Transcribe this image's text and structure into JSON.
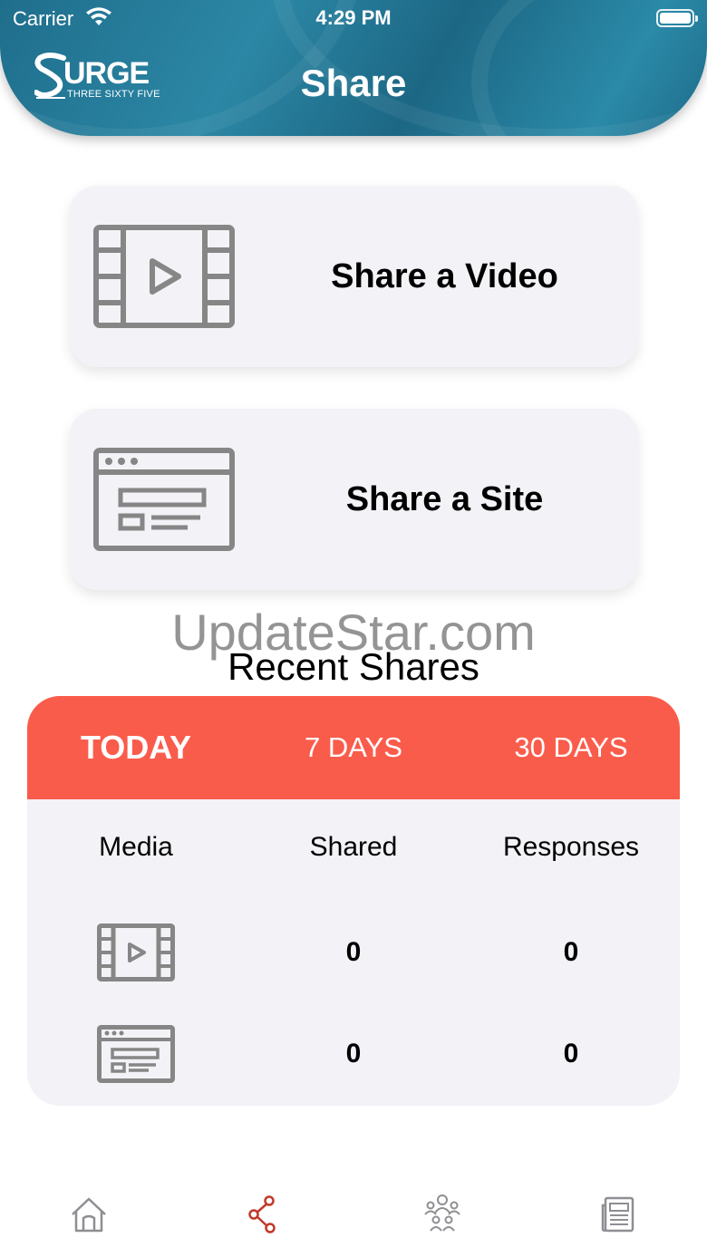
{
  "status_bar": {
    "carrier": "Carrier",
    "time": "4:29 PM"
  },
  "header": {
    "title": "Share",
    "logo": {
      "word": "URGE",
      "sub": "THREE SIXTY FIVE"
    }
  },
  "share_options": [
    {
      "label": "Share a Video",
      "icon": "film-play-icon"
    },
    {
      "label": "Share a Site",
      "icon": "browser-window-icon"
    }
  ],
  "watermark": "UpdateStar.com",
  "recent_shares": {
    "title": "Recent Shares",
    "tabs": [
      {
        "label": "TODAY",
        "active": true
      },
      {
        "label": "7 DAYS",
        "active": false
      },
      {
        "label": "30 DAYS",
        "active": false
      }
    ],
    "columns": [
      "Media",
      "Shared",
      "Responses"
    ],
    "rows": [
      {
        "media_icon": "film-play-icon",
        "shared": "0",
        "responses": "0"
      },
      {
        "media_icon": "browser-window-icon",
        "shared": "0",
        "responses": "0"
      }
    ],
    "accent_color": "#fa5c4b"
  },
  "bottom_nav": [
    {
      "icon": "home-icon",
      "active": false
    },
    {
      "icon": "share-icon",
      "active": true
    },
    {
      "icon": "people-icon",
      "active": false
    },
    {
      "icon": "newspaper-icon",
      "active": false
    }
  ],
  "colors": {
    "header": "#1f6e8c",
    "card_bg": "#f2f2f7",
    "icon_gray": "#868686",
    "nav_active": "#c0392b",
    "nav_inactive": "#8e8e93"
  }
}
